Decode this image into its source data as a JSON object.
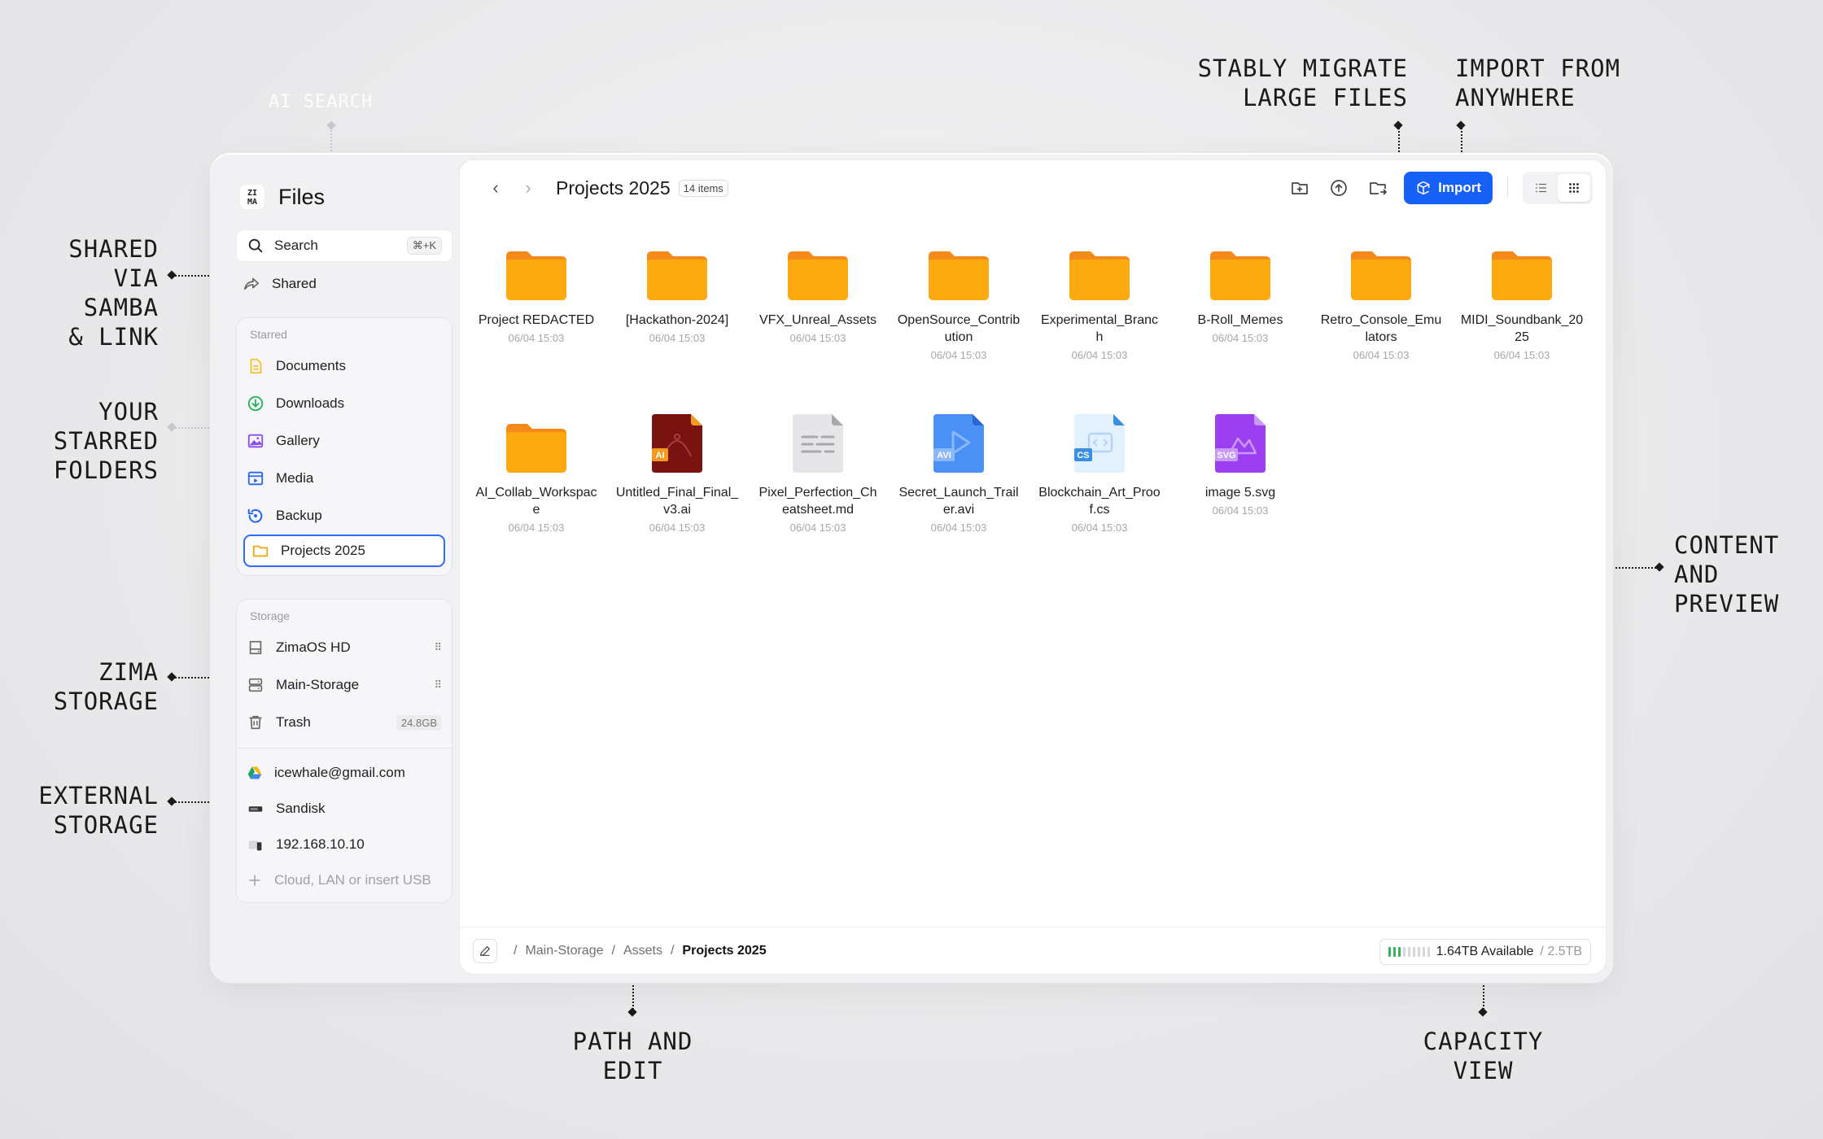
{
  "annotations": {
    "ai_search": "AI SEARCH",
    "shared_via": "SHARED\nVIA\nSAMBA\n& LINK",
    "starred_folders": "YOUR\nSTARRED\nFOLDERS",
    "zima_storage": "ZIMA\nSTORAGE",
    "external_storage": "EXTERNAL\nSTORAGE",
    "migrate": "STABLY MIGRATE\nLARGE FILES",
    "import_from": "IMPORT FROM\nANYWHERE",
    "content_preview": "CONTENT\nAND\nPREVIEW",
    "path_edit": "PATH AND\nEDIT",
    "capacity_view": "CAPACITY\nVIEW"
  },
  "app": {
    "logo_text": "ZI MA",
    "title": "Files"
  },
  "search": {
    "label": "Search",
    "shortcut": "⌘+K"
  },
  "shared": {
    "label": "Shared"
  },
  "starred": {
    "title": "Starred",
    "items": [
      {
        "label": "Documents",
        "icon": "document-icon",
        "color": "#f2c230"
      },
      {
        "label": "Downloads",
        "icon": "download-icon",
        "color": "#21b35a"
      },
      {
        "label": "Gallery",
        "icon": "gallery-icon",
        "color": "#8a4bf0"
      },
      {
        "label": "Media",
        "icon": "media-icon",
        "color": "#2a66e8"
      },
      {
        "label": "Backup",
        "icon": "backup-icon",
        "color": "#2a66e8"
      },
      {
        "label": "Projects 2025",
        "icon": "folder-icon",
        "color": "#f4a613"
      }
    ]
  },
  "storage": {
    "title": "Storage",
    "items": [
      {
        "label": "ZimaOS HD",
        "icon": "drive-icon"
      },
      {
        "label": "Main-Storage",
        "icon": "server-icon"
      },
      {
        "label": "Trash",
        "icon": "trash-icon",
        "badge": "24.8GB"
      }
    ],
    "external": [
      {
        "label": "icewhale@gmail.com",
        "icon": "google-drive-icon"
      },
      {
        "label": "Sandisk",
        "icon": "usb-drive-icon"
      },
      {
        "label": "192.168.10.10",
        "icon": "network-drive-icon"
      }
    ],
    "add_label": "Cloud, LAN or insert USB"
  },
  "toolbar": {
    "folder_title": "Projects 2025",
    "item_count": "14 items",
    "import_label": "Import"
  },
  "files": [
    {
      "name": "Project REDACTED",
      "date": "06/04 15:03",
      "type": "folder"
    },
    {
      "name": "[Hackathon-2024]",
      "date": "06/04 15:03",
      "type": "folder"
    },
    {
      "name": "VFX_Unreal_Assets",
      "date": "06/04 15:03",
      "type": "folder"
    },
    {
      "name": "OpenSource_Contribution",
      "date": "06/04 15:03",
      "type": "folder"
    },
    {
      "name": "Experimental_Branch",
      "date": "06/04 15:03",
      "type": "folder"
    },
    {
      "name": "B-Roll_Memes",
      "date": "06/04 15:03",
      "type": "folder"
    },
    {
      "name": "Retro_Console_Emulators",
      "date": "06/04 15:03",
      "type": "folder"
    },
    {
      "name": "MIDI_Soundbank_2025",
      "date": "06/04 15:03",
      "type": "folder"
    },
    {
      "name": "AI_Collab_Workspace",
      "date": "06/04 15:03",
      "type": "folder"
    },
    {
      "name": "Untitled_Final_Final_v3.ai",
      "date": "06/04 15:03",
      "type": "ai",
      "tag": "AI"
    },
    {
      "name": "Pixel_Perfection_Cheatsheet.md",
      "date": "06/04 15:03",
      "type": "md"
    },
    {
      "name": "Secret_Launch_Trailer.avi",
      "date": "06/04 15:03",
      "type": "avi",
      "tag": "AVI"
    },
    {
      "name": "Blockchain_Art_Proof.cs",
      "date": "06/04 15:03",
      "type": "cs",
      "tag": "CS"
    },
    {
      "name": "image 5.svg",
      "date": "06/04 15:03",
      "type": "svg",
      "tag": "SVG"
    }
  ],
  "path": {
    "items": [
      "Main-Storage",
      "Assets"
    ],
    "current": "Projects 2025"
  },
  "capacity": {
    "available": "1.64TB Available",
    "total": "/ 2.5TB",
    "used_fraction": 0.34
  },
  "colors": {
    "accent": "#1660f5",
    "folder": "#fdaa10",
    "folder_tab": "#f38a1a"
  }
}
